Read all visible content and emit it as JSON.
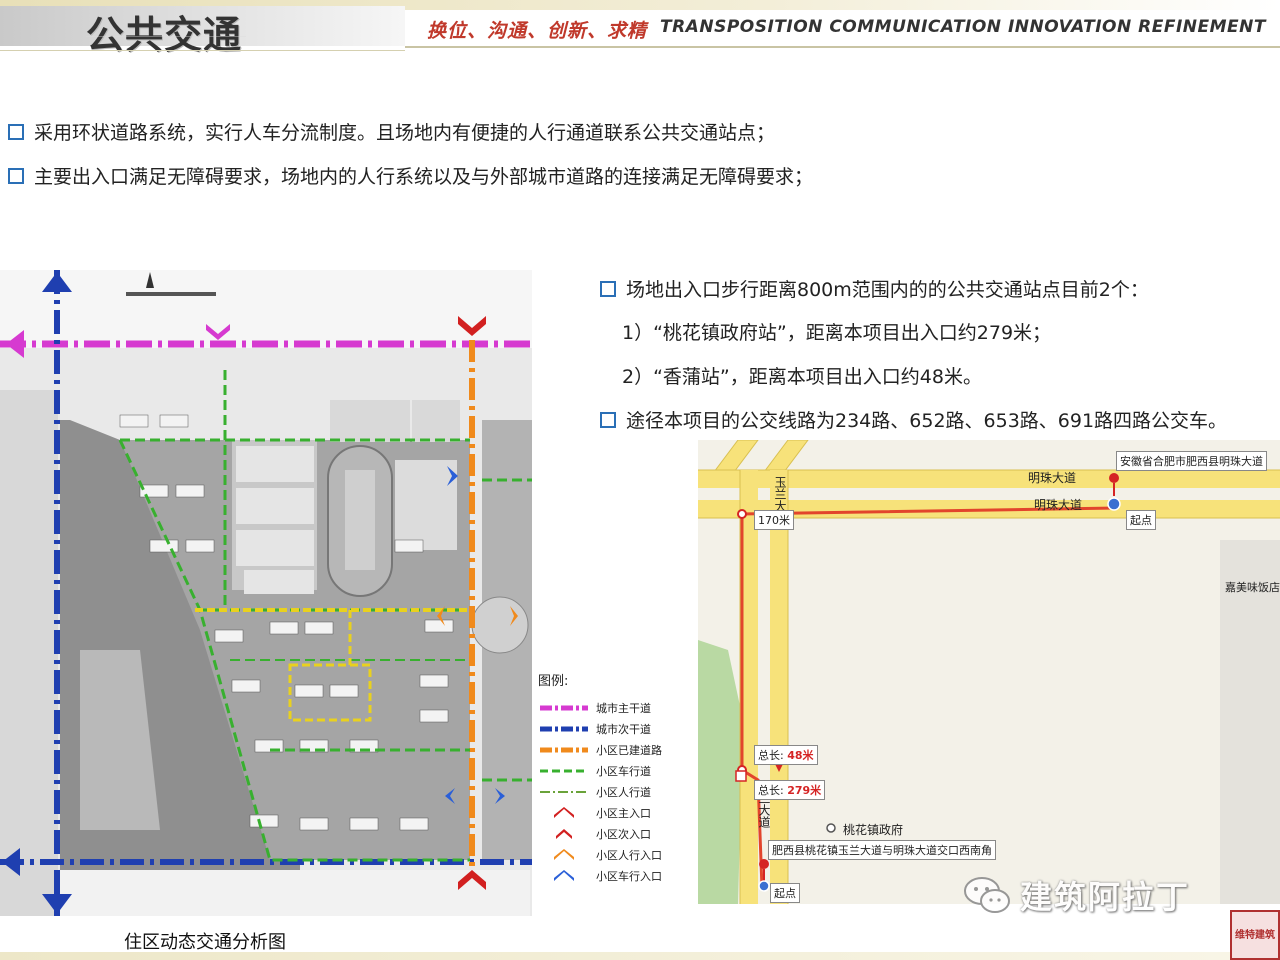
{
  "header": {
    "title": "公共交通",
    "slogan_cn": "换位、沟通、创新、求精",
    "slogan_en": "TRANSPOSITION COMMUNICATION INNOVATION REFINEMENT"
  },
  "bullets": [
    "采用环状道路系统，实行人车分流制度。且场地内有便捷的人行通道联系公共交通站点；",
    "主要出入口满足无障碍要求，场地内的人行系统以及与外部城市道路的连接满足无障碍要求；"
  ],
  "right_info": {
    "bullet1": "场地出入口步行距离800m范围内的的公共交通站点目前2个：",
    "line1": "1）“桃花镇政府站”，距离本项目出入口约279米；",
    "line2": "2）“香蒲站”，距离本项目出入口约48米。",
    "bullet2": "途径本项目的公交线路为234路、652路、653路、691路四路公交车。"
  },
  "site_plan": {
    "caption": "住区动态交通分析图",
    "legend_title": "图例:",
    "legend": [
      {
        "label": "城市主干道",
        "color": "#d63ad0",
        "style": "dash-dot"
      },
      {
        "label": "城市次干道",
        "color": "#1f3fb0",
        "style": "dash-dot"
      },
      {
        "label": "小区已建道路",
        "color": "#f08a1c",
        "style": "dash-dot"
      },
      {
        "label": "小区车行道",
        "color": "#38b02f",
        "style": "dash"
      },
      {
        "label": "小区人行道",
        "color": "#6aa33a",
        "style": "dash-dot"
      },
      {
        "label": "小区主入口",
        "color": "#d22020",
        "style": "chevron"
      },
      {
        "label": "小区次入口",
        "color": "#d22020",
        "style": "chevron"
      },
      {
        "label": "小区人行入口",
        "color": "#f08a1c",
        "style": "chevron"
      },
      {
        "label": "小区车行入口",
        "color": "#2a5fd8",
        "style": "chevron"
      }
    ]
  },
  "map": {
    "road_top": "明珠大道",
    "road_mid": "明珠大道",
    "road_left_a": "玉兰大道",
    "road_left_b": "玉兰大道",
    "box_top": "安徽省合肥市肥西县明珠大道",
    "start_top": "起点",
    "dist_170": "170米",
    "shop": "嘉美味饭店",
    "total_48_label": "总长:",
    "total_48_value": "48米",
    "total_279_label": "总长:",
    "total_279_value": "279米",
    "gov": "桃花镇政府",
    "box_bottom": "肥西县桃花镇玉兰大道与明珠大道交口西南角",
    "start_bottom": "起点"
  },
  "watermark": {
    "text": "建筑阿拉丁",
    "seal": "维特建筑"
  },
  "colors": {
    "accent_red": "#c0392b",
    "bullet_blue": "#2a6fb6"
  }
}
